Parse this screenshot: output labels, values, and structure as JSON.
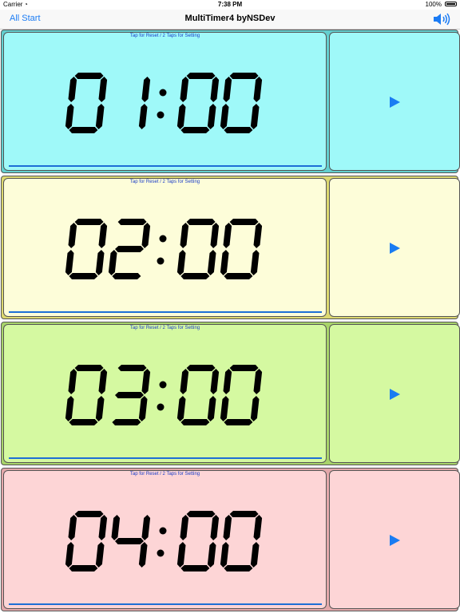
{
  "status_bar": {
    "carrier": "Carrier",
    "time": "7:38 PM",
    "battery": "100%"
  },
  "nav": {
    "left_button": "All Start",
    "title": "MultiTimer4 byNSDev",
    "right_icon": "speaker-icon"
  },
  "colors": {
    "accent": "#1c7cf4",
    "timer1_bg": "#9ff9f9",
    "timer1_frame": "#63cfcf",
    "timer2_bg": "#fdfdd9",
    "timer2_frame": "#dcd870",
    "timer3_bg": "#d5f9a1",
    "timer3_frame": "#a8d46a",
    "timer4_bg": "#fdd5d6",
    "timer4_frame": "#e3a8aa"
  },
  "timers": [
    {
      "hint": "Tap for Reset / 2 Taps for Setting",
      "time": "01:00",
      "progress": 1.0,
      "play_icon": "play-icon"
    },
    {
      "hint": "Tap for Reset / 2 Taps for Setting",
      "time": "02:00",
      "progress": 1.0,
      "play_icon": "play-icon"
    },
    {
      "hint": "Tap for Reset / 2 Taps for Setting",
      "time": "03:00",
      "progress": 1.0,
      "play_icon": "play-icon"
    },
    {
      "hint": "Tap for Reset / 2 Taps for Setting",
      "time": "04:00",
      "progress": 1.0,
      "play_icon": "play-icon"
    }
  ]
}
